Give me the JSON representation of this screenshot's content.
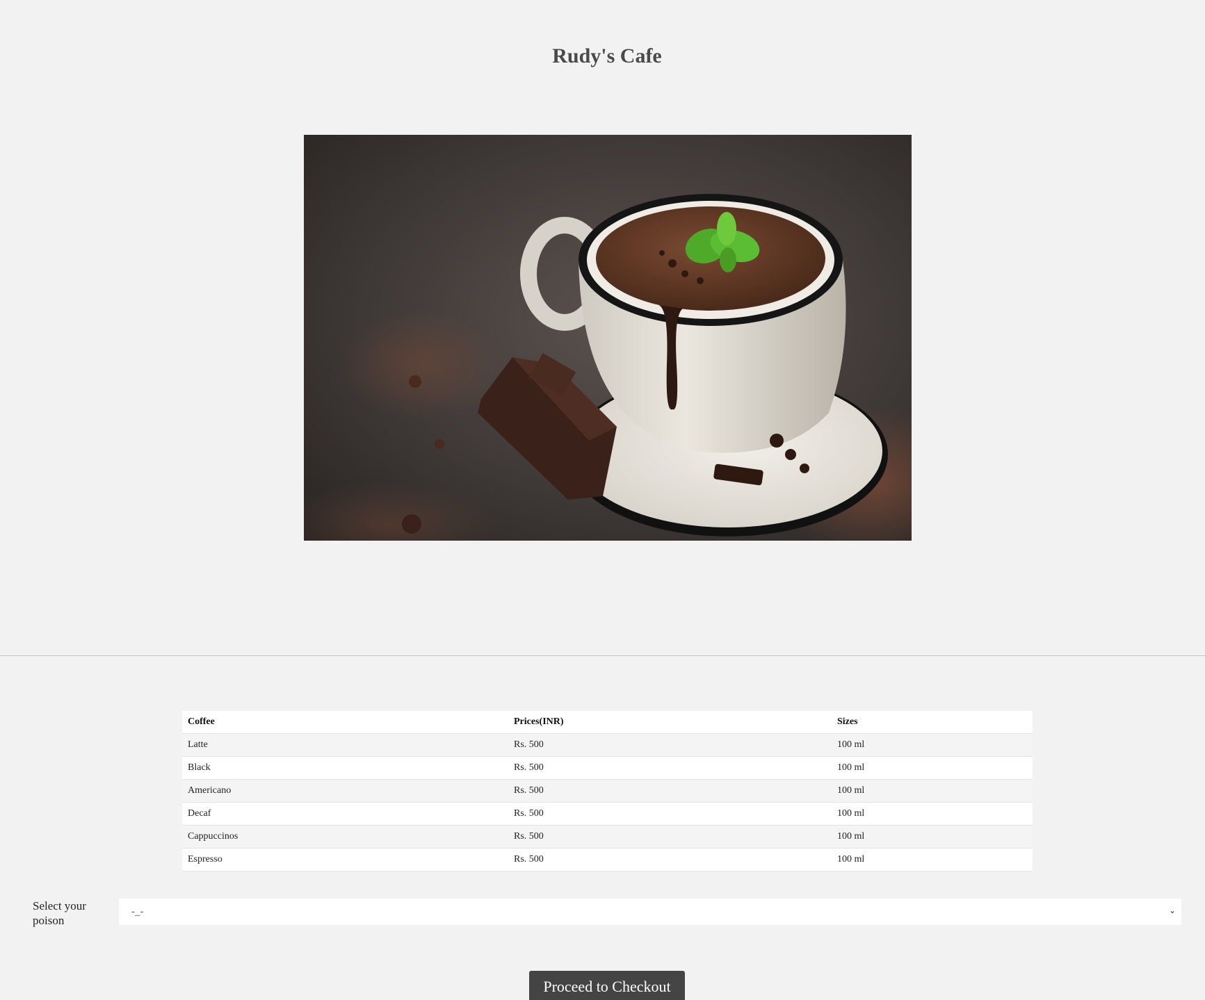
{
  "header": {
    "title": "Rudy's Cafe"
  },
  "hero": {
    "alt": "Hot chocolate cup with mint leaves on a saucer beside chocolate pieces"
  },
  "menu": {
    "columns": [
      "Coffee",
      "Prices(INR)",
      "Sizes"
    ],
    "rows": [
      [
        "Latte",
        "Rs. 500",
        "100 ml"
      ],
      [
        "Black",
        "Rs. 500",
        "100 ml"
      ],
      [
        "Americano",
        "Rs. 500",
        "100 ml"
      ],
      [
        "Decaf",
        "Rs. 500",
        "100 ml"
      ],
      [
        "Cappuccinos",
        "Rs. 500",
        "100 ml"
      ],
      [
        "Espresso",
        "Rs. 500",
        "100 ml"
      ]
    ]
  },
  "order": {
    "select_label": "Select your poison",
    "selected_value": "-_-",
    "checkout_label": "Proceed to Checkout"
  },
  "icons": {
    "dropdown": "chevron-down-icon"
  },
  "colors": {
    "background": "#f2f2f2",
    "button": "#444444",
    "title": "#4a4a4a"
  }
}
